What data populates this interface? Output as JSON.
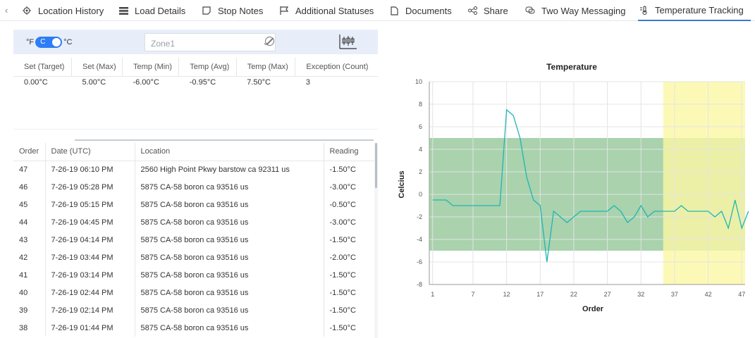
{
  "tabs": [
    {
      "label": "Location History",
      "icon": "target-icon"
    },
    {
      "label": "Load Details",
      "icon": "stack-icon"
    },
    {
      "label": "Stop Notes",
      "icon": "note-icon"
    },
    {
      "label": "Additional Statuses",
      "icon": "flag-icon"
    },
    {
      "label": "Documents",
      "icon": "document-icon"
    },
    {
      "label": "Share",
      "icon": "share-icon"
    },
    {
      "label": "Two Way Messaging",
      "icon": "message-icon"
    },
    {
      "label": "Temperature Tracking",
      "icon": "thermometer-icon",
      "active": true
    }
  ],
  "toolbar": {
    "unit_f": "°F",
    "unit_toggle": "C",
    "unit_c": "°C",
    "zone_value": "Zone1"
  },
  "summary": {
    "headers": [
      "Set (Target)",
      "Set (Max)",
      "Temp (Min)",
      "Temp (Avg)",
      "Temp (Max)",
      "Exception (Count)"
    ],
    "values": [
      "0.00°C",
      "5.00°C",
      "-6.00°C",
      "-0.95°C",
      "7.50°C",
      "3"
    ]
  },
  "readings": {
    "headers": [
      "Order",
      "Date (UTC)",
      "Location",
      "Reading"
    ],
    "rows": [
      [
        "47",
        "7-26-19 06:10 PM",
        "2560 High Point Pkwy barstow ca 92311 us",
        "-1.50°C"
      ],
      [
        "46",
        "7-26-19 05:28 PM",
        "5875 CA-58 boron ca 93516 us",
        "-3.00°C"
      ],
      [
        "45",
        "7-26-19 05:15 PM",
        "5875 CA-58 boron ca 93516 us",
        "-0.50°C"
      ],
      [
        "44",
        "7-26-19 04:45 PM",
        "5875 CA-58 boron ca 93516 us",
        "-3.00°C"
      ],
      [
        "43",
        "7-26-19 04:14 PM",
        "5875 CA-58 boron ca 93516 us",
        "-1.50°C"
      ],
      [
        "42",
        "7-26-19 03:44 PM",
        "5875 CA-58 boron ca 93516 us",
        "-2.00°C"
      ],
      [
        "41",
        "7-26-19 03:14 PM",
        "5875 CA-58 boron ca 93516 us",
        "-1.50°C"
      ],
      [
        "40",
        "7-26-19 02:44 PM",
        "5875 CA-58 boron ca 93516 us",
        "-1.50°C"
      ],
      [
        "39",
        "7-26-19 02:14 PM",
        "5875 CA-58 boron ca 93516 us",
        "-1.50°C"
      ],
      [
        "38",
        "7-26-19 01:44 PM",
        "5875 CA-58 boron ca 93516 us",
        "-1.50°C"
      ]
    ]
  },
  "chart_data": {
    "type": "line",
    "title": "Temperature",
    "xlabel": "Order",
    "ylabel": "Celcius",
    "xlim": [
      1,
      47
    ],
    "ylim": [
      -8,
      10
    ],
    "xticks": [
      1,
      7,
      12,
      17,
      22,
      27,
      32,
      37,
      42,
      47
    ],
    "yticks": [
      -8,
      -6,
      -4,
      -2,
      0,
      2,
      4,
      6,
      8,
      10
    ],
    "grid": true,
    "series_color": "#1fb5b5",
    "x": [
      1,
      2,
      3,
      4,
      5,
      6,
      7,
      8,
      9,
      10,
      11,
      12,
      13,
      14,
      15,
      16,
      17,
      18,
      19,
      20,
      21,
      22,
      23,
      24,
      25,
      26,
      27,
      28,
      29,
      30,
      31,
      32,
      33,
      34,
      35,
      36,
      37,
      38,
      39,
      40,
      41,
      42,
      43,
      44,
      45,
      46,
      47
    ],
    "y": [
      -0.5,
      -0.5,
      -0.5,
      -1.0,
      -1.0,
      -1.0,
      -1.0,
      -1.0,
      -1.0,
      -1.0,
      -1.0,
      7.5,
      7.0,
      5.0,
      1.5,
      -0.5,
      -1.0,
      -6.0,
      -1.5,
      -2.0,
      -2.5,
      -2.0,
      -1.5,
      -1.5,
      -1.5,
      -1.5,
      -1.5,
      -1.0,
      -1.5,
      -2.5,
      -2.0,
      -1.0,
      -2.0,
      -1.5,
      -1.5,
      -1.5,
      -1.5,
      -1.0,
      -1.5,
      -1.5,
      -1.5,
      -1.5,
      -2.0,
      -1.5,
      -3.0,
      -0.5,
      -3.0,
      -1.5
    ],
    "range_band": {
      "low": -5,
      "high": 5,
      "color": "#a9d2ad"
    },
    "exception_band": {
      "x_start": 35.3,
      "x_end": 47.5,
      "color": "#fbf7a4"
    }
  }
}
